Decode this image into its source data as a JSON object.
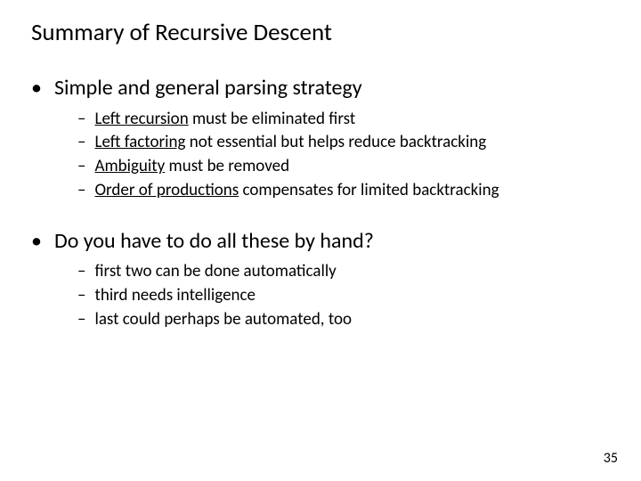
{
  "title": "Summary of Recursive Descent",
  "bullets": [
    {
      "text": "Simple and general parsing strategy",
      "subs": [
        {
          "underlined": "Left recursion",
          "rest": " must be eliminated first"
        },
        {
          "underlined": "Left factoring",
          "rest": " not essential but helps reduce backtracking"
        },
        {
          "underlined": "Ambiguity",
          "rest": " must be removed"
        },
        {
          "underlined": "Order of productions",
          "rest": " compensates for limited backtracking"
        }
      ]
    },
    {
      "text": "Do you have to do all these by hand?",
      "subs": [
        {
          "underlined": "",
          "rest": "first two can be done automatically"
        },
        {
          "underlined": "",
          "rest": "third needs intelligence"
        },
        {
          "underlined": "",
          "rest": "last could perhaps be automated, too"
        }
      ]
    }
  ],
  "page_number": "35"
}
